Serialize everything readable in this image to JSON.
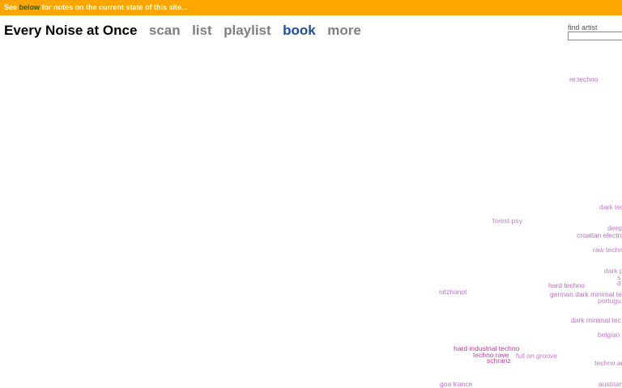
{
  "banner": {
    "prefix": "See ",
    "link": "below",
    "suffix": " for notes on the current state of this site..."
  },
  "header": {
    "title": "Every Noise at Once",
    "nav": [
      {
        "label": "scan",
        "active": false
      },
      {
        "label": "list",
        "active": false
      },
      {
        "label": "playlist",
        "active": false
      },
      {
        "label": "book",
        "active": true
      },
      {
        "label": "more",
        "active": false
      }
    ]
  },
  "search": {
    "label": "find artist",
    "value": ""
  },
  "colors": {
    "banner_bg": "#ffa500",
    "nav_inactive": "#808080",
    "nav_active": "#1f4e9c"
  },
  "genres": [
    {
      "label": "re:techno",
      "color": "#b96fbf"
    },
    {
      "label": "dark tec",
      "color": "#c77bc9"
    },
    {
      "label": "forest psy",
      "color": "#c67bcf"
    },
    {
      "label": "deep",
      "color": "#c57ac6"
    },
    {
      "label": "croatian electro",
      "color": "#bb6fc2"
    },
    {
      "label": "raw techn",
      "color": "#c27cc6"
    },
    {
      "label": "dark p",
      "color": "#c07bc8"
    },
    {
      "label": "s",
      "color": "#c27cc6"
    },
    {
      "label": "d",
      "color": "#c27cc6"
    },
    {
      "label": "hard techno",
      "color": "#bf68c0"
    },
    {
      "label": "nitzhonot",
      "color": "#c06fd0"
    },
    {
      "label": "german dark minimal te",
      "color": "#bb71c0"
    },
    {
      "label": "portugu",
      "color": "#c27bc8"
    },
    {
      "label": "dark minimal tec",
      "color": "#b974c2"
    },
    {
      "label": "belgian",
      "color": "#c27bc8"
    },
    {
      "label": "hard industrial techno",
      "color": "#c0399b"
    },
    {
      "label": "techno rave",
      "color": "#c23ea1"
    },
    {
      "label": "full on groove",
      "color": "#c278d0"
    },
    {
      "label": "schranz",
      "color": "#c23ea1"
    },
    {
      "label": "techno ar",
      "color": "#c27bc8"
    },
    {
      "label": "goa trance",
      "color": "#c06fd0"
    },
    {
      "label": "austrian",
      "color": "#c27bc8"
    }
  ]
}
